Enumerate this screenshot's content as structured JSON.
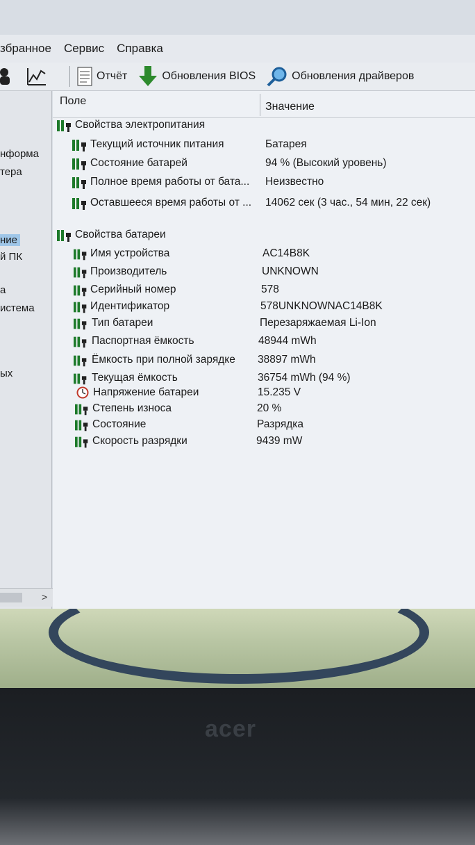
{
  "menu": [
    "збранное",
    "Сервис",
    "Справка"
  ],
  "toolbar": {
    "report": "Отчёт",
    "bios": "Обновления BIOS",
    "drivers": "Обновления драйверов"
  },
  "left_pane": [
    "нформа",
    "тера",
    "ние",
    "й ПК",
    "а",
    "истема",
    "ых"
  ],
  "columns": {
    "field": "Поле",
    "value": "Значение"
  },
  "power": {
    "title": "Свойства электропитания",
    "rows": [
      {
        "label": "Текущий источник питания",
        "value": "Батарея"
      },
      {
        "label": "Состояние батарей",
        "value": "94 % (Высокий уровень)"
      },
      {
        "label": "Полное время работы от бата...",
        "value": "Неизвестно"
      },
      {
        "label": "Оставшееся время работы от ...",
        "value": "14062 сек (3 час., 54 мин, 22 сек)"
      }
    ]
  },
  "battery": {
    "title": "Свойства батареи",
    "rows": [
      {
        "label": "Имя устройства",
        "value": "AC14B8K"
      },
      {
        "label": "Производитель",
        "value": "UNKNOWN"
      },
      {
        "label": "Серийный номер",
        "value": "578"
      },
      {
        "label": "Идентификатор",
        "value": "578UNKNOWNAC14B8K"
      },
      {
        "label": "Тип батареи",
        "value": "Перезаряжаемая Li-Ion"
      },
      {
        "label": "Паспортная ёмкость",
        "value": "48944 mWh"
      },
      {
        "label": "Ёмкость при полной зарядке",
        "value": "38897 mWh"
      },
      {
        "label": "Текущая ёмкость",
        "value": "36754 mWh  (94 %)"
      },
      {
        "label": "Напряжение батареи",
        "value": "15.235 V"
      },
      {
        "label": "Степень износа",
        "value": "20 %"
      },
      {
        "label": "Состояние",
        "value": "Разрядка"
      },
      {
        "label": "Скорость разрядки",
        "value": "9439 mW"
      }
    ]
  },
  "bezel_logo": "acer",
  "colors": {
    "icon_green": "#1d7a2a",
    "selection": "#9fc6e8",
    "clock_red": "#c0392b"
  }
}
